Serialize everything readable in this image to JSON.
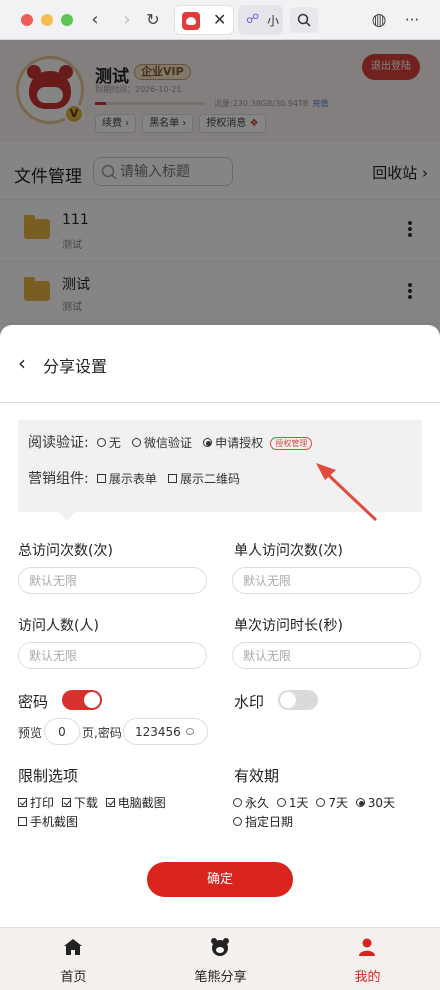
{
  "browser": {
    "tab_active_title": "",
    "tab_secondary_title": "小",
    "colors": {
      "red": "#ec5f56",
      "yellow": "#f4bd4f",
      "green": "#5fc454"
    }
  },
  "profile": {
    "name": "测试",
    "vip_badge": "企业VIP",
    "expire_text": "到期时间：2026-10-21",
    "traffic_text": "流量:230.38GB/30.94TB",
    "traffic_link": "充值",
    "traffic_used_fraction": 0.1,
    "chips": [
      "续费 ›",
      "黑名单 ›",
      "授权消息"
    ],
    "logout_label": "退出登陆"
  },
  "file_manager": {
    "title": "文件管理",
    "search_placeholder": "请输入标题",
    "recycle_label": "回收站 ›",
    "files": [
      {
        "name": "111",
        "sub": "测试"
      },
      {
        "name": "测试",
        "sub": "测试"
      }
    ]
  },
  "share_settings": {
    "title": "分享设置",
    "read_verify": {
      "label": "阅读验证:",
      "options": [
        "无",
        "微信验证",
        "申请授权"
      ],
      "selected": "申请授权",
      "auth_manage_label": "授权管理"
    },
    "marketing": {
      "label": "营销组件:",
      "options": [
        "展示表单",
        "展示二维码"
      ]
    },
    "total_visits_label": "总访问次数(次)",
    "total_visits_placeholder": "默认无限",
    "per_user_visits_label": "单人访问次数(次)",
    "per_user_visits_placeholder": "默认无限",
    "visitor_count_label": "访问人数(人)",
    "visitor_count_placeholder": "默认无限",
    "single_duration_label": "单次访问时长(秒)",
    "single_duration_placeholder": "默认无限",
    "password_label": "密码",
    "password_enabled": true,
    "watermark_label": "水印",
    "watermark_enabled": false,
    "preview_label": "预览",
    "preview_pages": "0",
    "page_password_label": "页,密码",
    "password_value": "123456",
    "restrict_label": "限制选项",
    "restrict_options": [
      "打印",
      "下载",
      "电脑截图",
      "手机截图"
    ],
    "restrict_checked": [
      "打印",
      "下载",
      "电脑截图"
    ],
    "validity_label": "有效期",
    "validity_options": [
      "永久",
      "1天",
      "7天",
      "30天",
      "指定日期"
    ],
    "validity_selected": "30天",
    "confirm_label": "确定"
  },
  "tabbar": {
    "items": [
      {
        "label": "首页",
        "icon": "home-icon"
      },
      {
        "label": "笔熊分享",
        "icon": "bear-icon"
      },
      {
        "label": "我的",
        "icon": "user-icon"
      }
    ],
    "active": "我的",
    "accent": "#d9241e"
  }
}
